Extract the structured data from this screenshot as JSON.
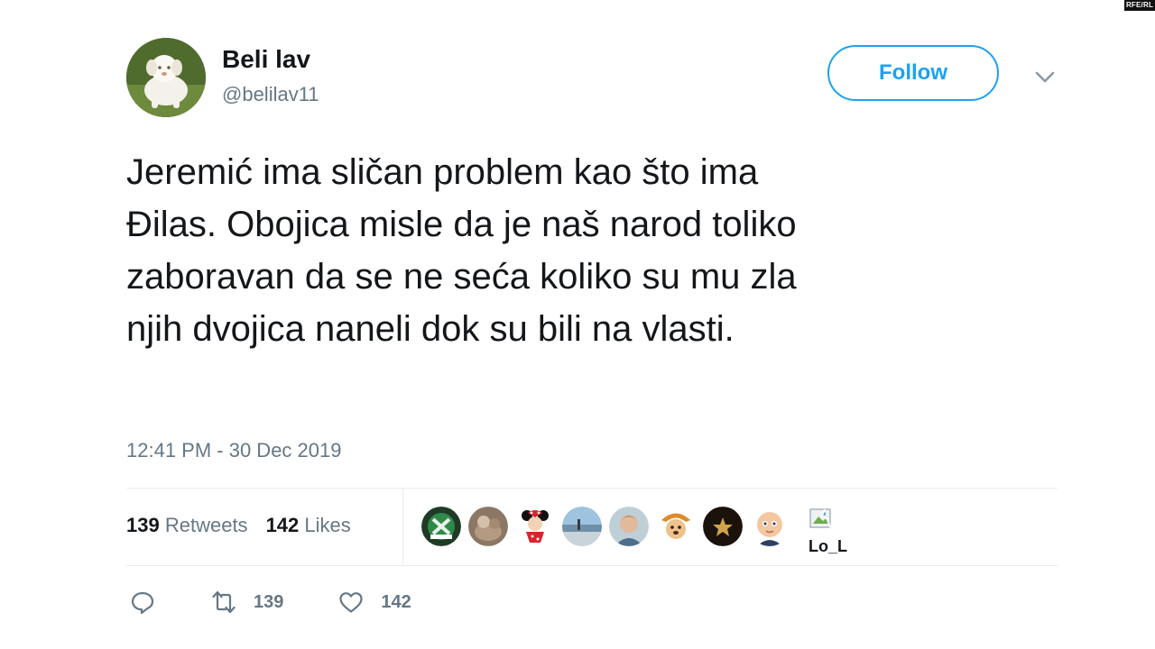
{
  "watermark": "RFE/RL",
  "author": {
    "display_name": "Beli lav",
    "handle": "@belilav11",
    "avatar_icon": "white-puppy-avatar"
  },
  "follow_label": "Follow",
  "accent_color": "#1da1f2",
  "tweet": {
    "text": "Jeremić ima sličan problem kao što ima\nĐilas. Obojica misle da je naš narod toliko\nzaboravan da se ne seća koliko su mu zla\nnjih dvojica naneli dok su bili na vlasti.",
    "timestamp": "12:41 PM - 30 Dec 2019"
  },
  "stats": {
    "retweets_count": "139",
    "retweets_label": "Retweets",
    "likes_count": "142",
    "likes_label": "Likes"
  },
  "likers": [
    {
      "icon": "green-emblem-avatar"
    },
    {
      "icon": "photo-avatar"
    },
    {
      "icon": "cartoon-mouse-avatar"
    },
    {
      "icon": "landscape-avatar"
    },
    {
      "icon": "person-avatar"
    },
    {
      "icon": "cartoon-dog-avatar"
    },
    {
      "icon": "dark-star-avatar"
    },
    {
      "icon": "baby-face-avatar"
    }
  ],
  "broken_avatar_label": "Lo_L",
  "actions": {
    "reply_icon": "reply-icon",
    "retweet_icon": "retweet-icon",
    "retweet_count": "139",
    "like_icon": "heart-icon",
    "like_count": "142"
  }
}
